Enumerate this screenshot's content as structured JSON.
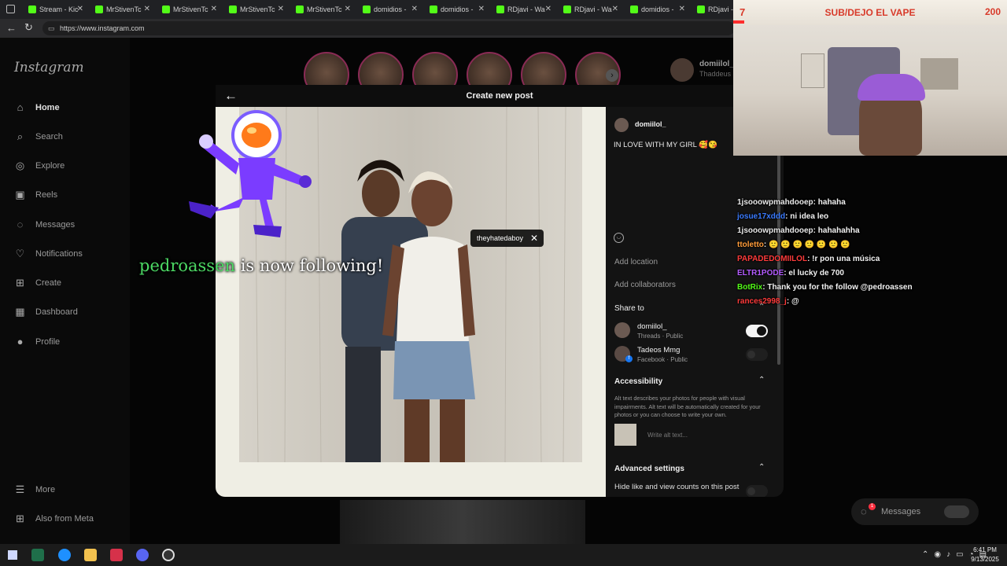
{
  "browser": {
    "tabs": [
      {
        "label": "Stream - Kic"
      },
      {
        "label": "MrStivenTc"
      },
      {
        "label": "MrStivenTc"
      },
      {
        "label": "MrStivenTc"
      },
      {
        "label": "MrStivenTc"
      },
      {
        "label": "domidios -"
      },
      {
        "label": "domidios -"
      },
      {
        "label": "RDjavi - Wa"
      },
      {
        "label": "RDjavi - Wa"
      },
      {
        "label": "domidios -"
      },
      {
        "label": "RDjavi -"
      }
    ],
    "url": "https://www.instagram.com"
  },
  "instagram": {
    "logo": "Instagram",
    "nav": [
      {
        "label": "Home",
        "icon": "home-icon",
        "glyph": "⌂"
      },
      {
        "label": "Search",
        "icon": "search-icon",
        "glyph": "⌕"
      },
      {
        "label": "Explore",
        "icon": "compass-icon",
        "glyph": "◎"
      },
      {
        "label": "Reels",
        "icon": "reels-icon",
        "glyph": "▣"
      },
      {
        "label": "Messages",
        "icon": "messenger-icon",
        "glyph": "◌"
      },
      {
        "label": "Notifications",
        "icon": "heart-icon",
        "glyph": "♡"
      },
      {
        "label": "Create",
        "icon": "plus-square-icon",
        "glyph": "⊞"
      },
      {
        "label": "Dashboard",
        "icon": "chart-icon",
        "glyph": "▦"
      },
      {
        "label": "Profile",
        "icon": "avatar-icon",
        "glyph": "●"
      }
    ],
    "more": "More",
    "also_from_meta": "Also from Meta",
    "suggested_user": "domiilol_",
    "suggested_sub": "Thaddeus",
    "messages_pill": "Messages",
    "messages_badge": "1"
  },
  "modal": {
    "title": "Create new post",
    "tag_label": "theyhatedaboy",
    "username": "domiilol_",
    "caption": "IN LOVE WITH MY GIRL 🥰😘",
    "add_location": "Add location",
    "add_collaborators": "Add collaborators",
    "share_to": "Share to",
    "share_accounts": [
      {
        "name": "domiilol_",
        "sub": "Threads · Public",
        "enabled": true
      },
      {
        "name": "Tadeos Mmg",
        "sub": "Facebook · Public",
        "enabled": false
      }
    ],
    "accessibility": "Accessibility",
    "accessibility_desc": "Alt text describes your photos for people with visual impairments. Alt text will be automatically created for your photos or you can choose to write your own.",
    "alt_placeholder": "Write alt text...",
    "advanced_settings": "Advanced settings",
    "hide_likes": "Hide like and view counts on this post"
  },
  "overlay": {
    "follow_alert_user": "pedroassen",
    "follow_alert_text": "is now following!",
    "goal_left": "7",
    "goal_title": "SUB/DEJO EL VAPE",
    "goal_right": "200",
    "chat": [
      {
        "user": "1jsooowpmahdooep",
        "msg": ": hahaha",
        "color": "#e8e8e8"
      },
      {
        "user": "josue17xddd",
        "msg": ": ni idea leo",
        "color": "#3a7bff"
      },
      {
        "user": "1jsooowpmahdooep",
        "msg": ": hahahahha",
        "color": "#e8e8e8"
      },
      {
        "user": "ttoletto",
        "msg": ": 🙂 🙂 🙂 🙂 🙂 🙂 🙂",
        "color": "#ff9c3a"
      },
      {
        "user": "PAPADEDOMIILOL",
        "msg": ": !r pon una música",
        "color": "#ff3b3b"
      },
      {
        "user": "ELTR1PODE",
        "msg": ": el lucky de 700",
        "color": "#b45cff"
      },
      {
        "user": "BotRix",
        "msg": ": Thank you for the follow @pedroassen",
        "color": "#53fc18"
      },
      {
        "user": "rances2998_j",
        "msg": ": @",
        "color": "#ff3b3b"
      }
    ]
  },
  "taskbar": {
    "time": "6:41 PM",
    "date": "9/13/2025"
  }
}
